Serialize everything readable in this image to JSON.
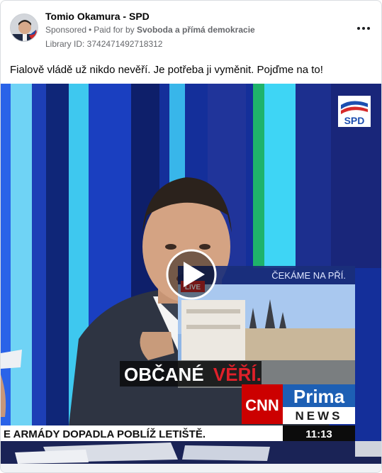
{
  "post": {
    "page_name": "Tomio Okamura - SPD",
    "sponsored": "Sponsored",
    "separator": "•",
    "paid_for_prefix": "Paid for by",
    "payer": "Svoboda a přímá demokracie",
    "library_id": "Library ID: 3742471492718312",
    "text": "Fialově vládě už nikdo nevěří. Je potřeba ji vyměnit. Pojďme na to!"
  },
  "video": {
    "party_logo_text": "SPD",
    "inset_title": "ČEKÁME NA PŘÍ.",
    "live_badge": "LIVE",
    "subtitle_white": "OBČANÉ",
    "subtitle_red": "VĚŘÍ.",
    "cnn_logo": "CNN",
    "prima_logo": "Prima",
    "news_logo": "NEWS",
    "ticker": "E ARMÁDY DOPADLA POBLÍŽ LETIŠTĚ.",
    "clock": "11:13"
  },
  "icons": {
    "more": "more-horizontal-icon",
    "play": "play-icon"
  },
  "colors": {
    "studio_blue": "#1a3aa8",
    "cnn_red": "#cc0000",
    "prima_blue": "#1d5fb4",
    "subtitle_red": "#e0202a"
  }
}
